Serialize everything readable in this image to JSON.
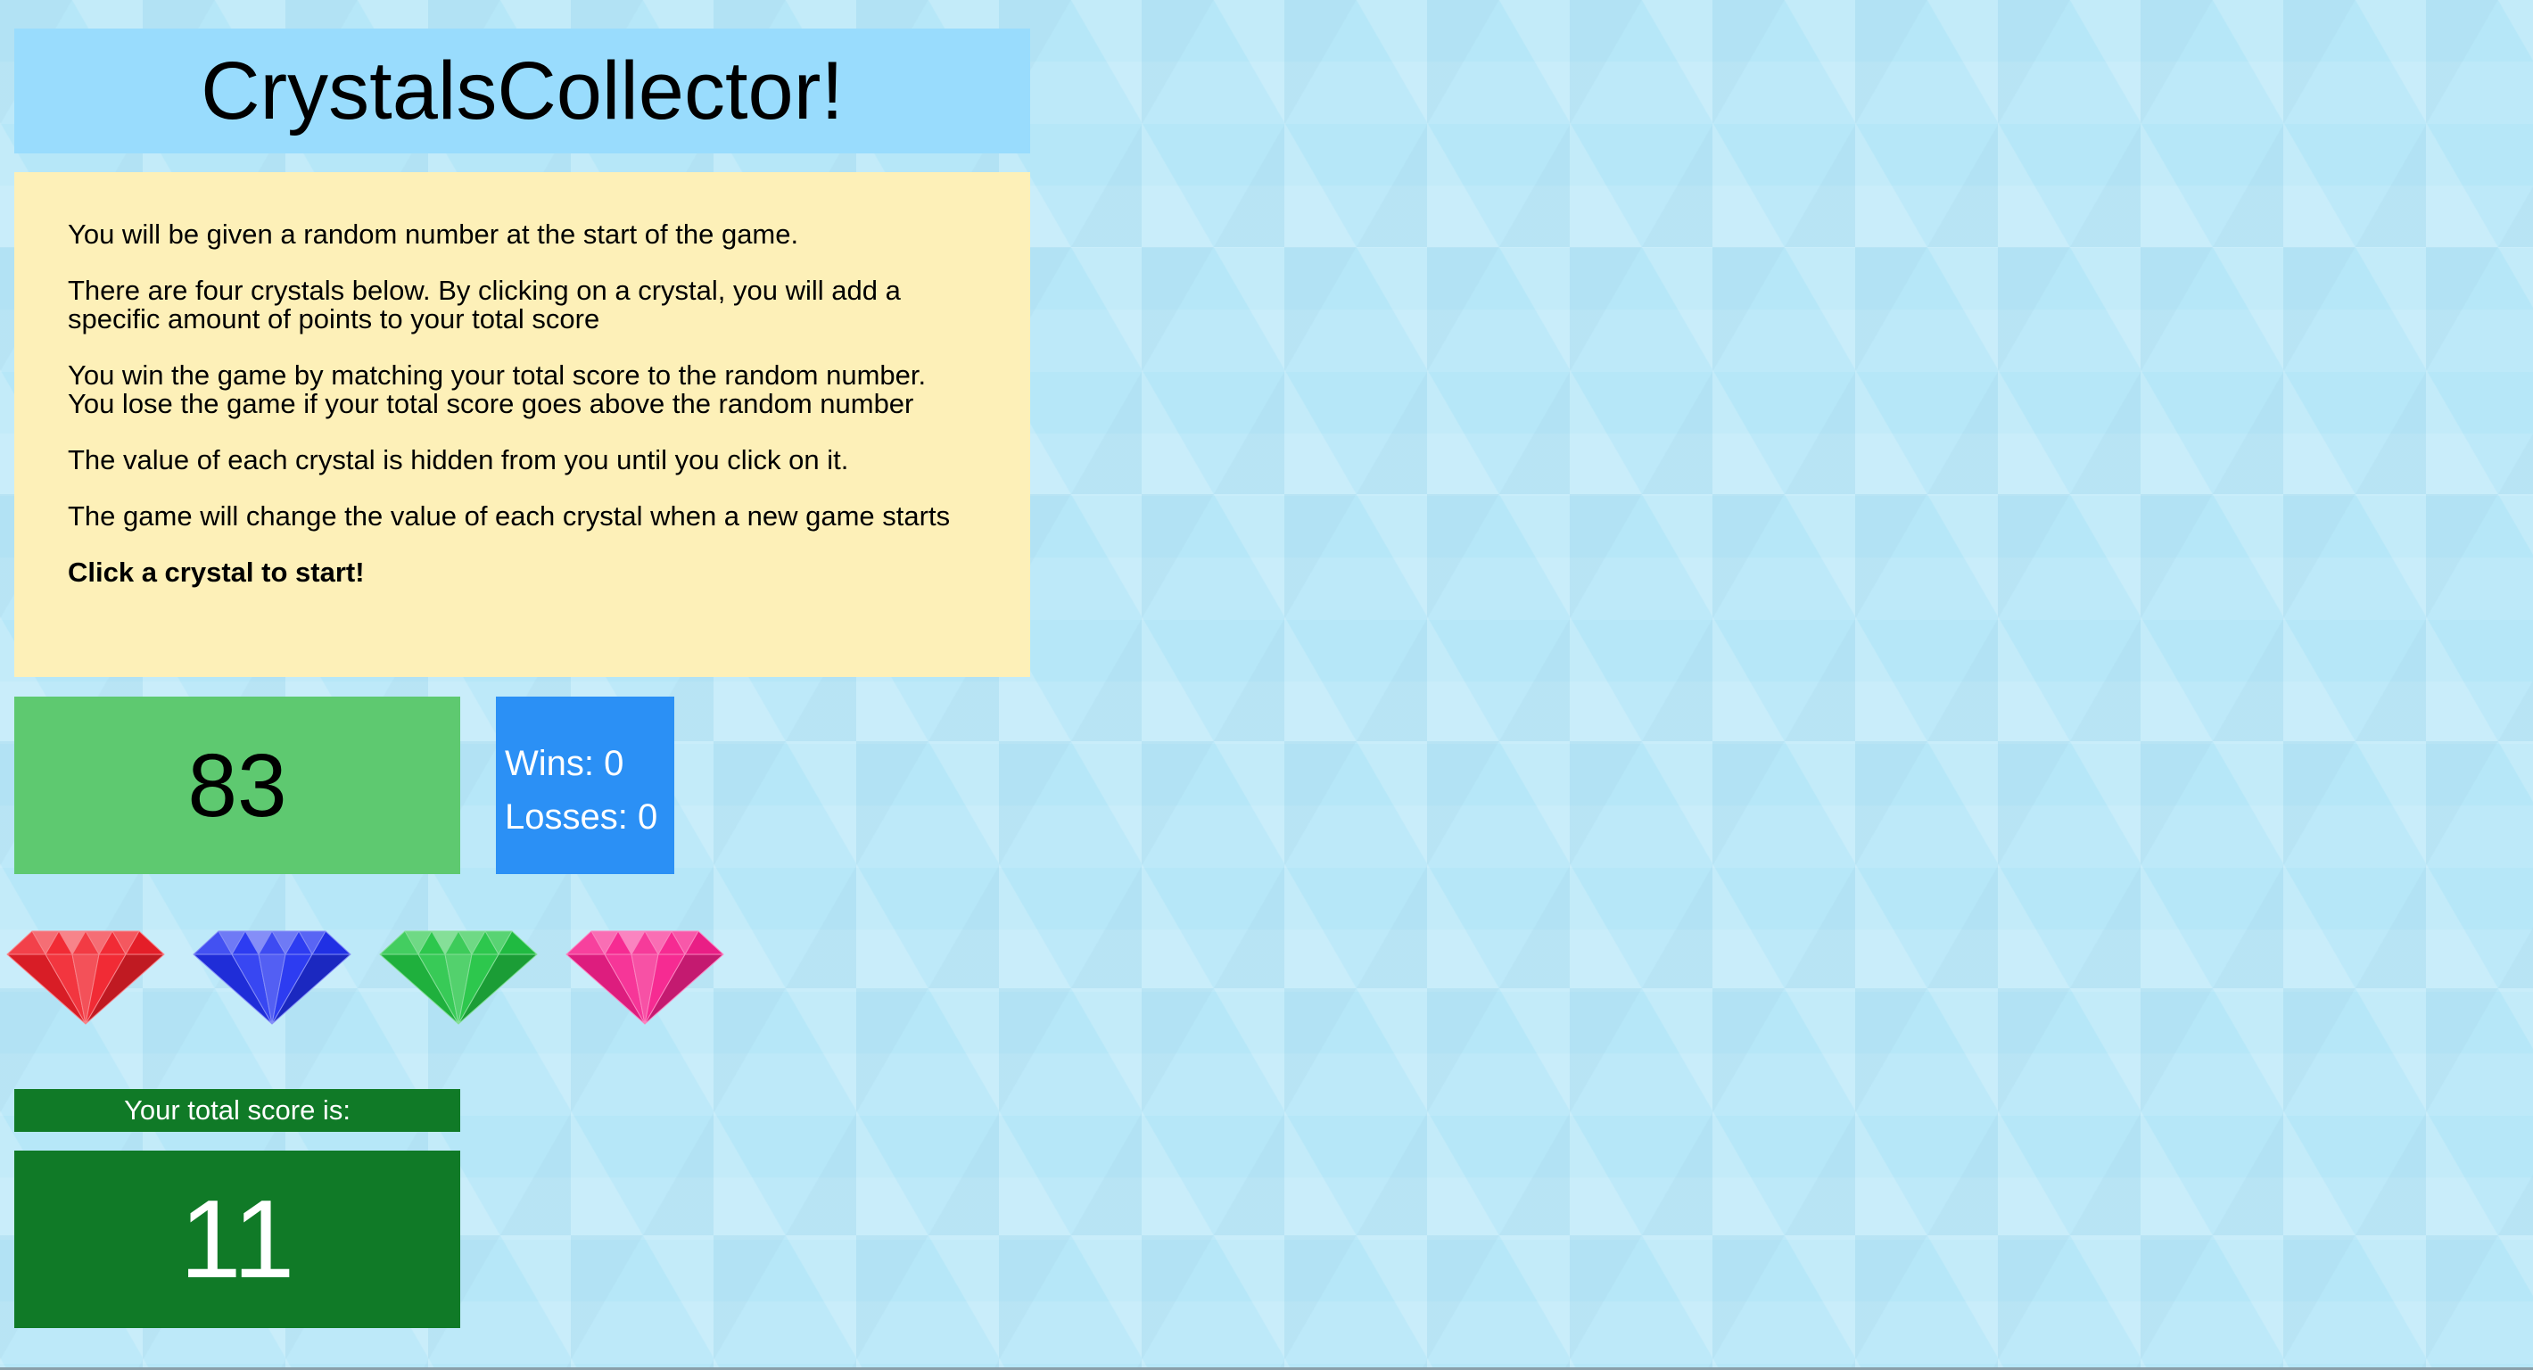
{
  "header": {
    "title": "CrystalsCollector!"
  },
  "instructions": {
    "paragraphs": [
      "You will be given a random number at the start of the game.",
      "There are four crystals below. By clicking on a crystal, you will add a specific amount of points to your total score",
      "You win the game by matching your total score to the random number. You lose the game if your total score goes above the random number",
      "The value of each crystal is hidden from you until you click on it.",
      "The game will change the value of each crystal when a new game starts"
    ],
    "cta": "Click a crystal to start!"
  },
  "target": {
    "number": "83"
  },
  "stats": {
    "wins_text": "Wins: 0",
    "losses_text": "Losses: 0"
  },
  "crystals": [
    {
      "name": "red-crystal",
      "color": "#f0202a"
    },
    {
      "name": "blue-crystal",
      "color": "#2232f0"
    },
    {
      "name": "green-crystal",
      "color": "#22c444"
    },
    {
      "name": "pink-crystal",
      "color": "#f5208c"
    }
  ],
  "score": {
    "label": "Your total score is:",
    "value": "11"
  }
}
